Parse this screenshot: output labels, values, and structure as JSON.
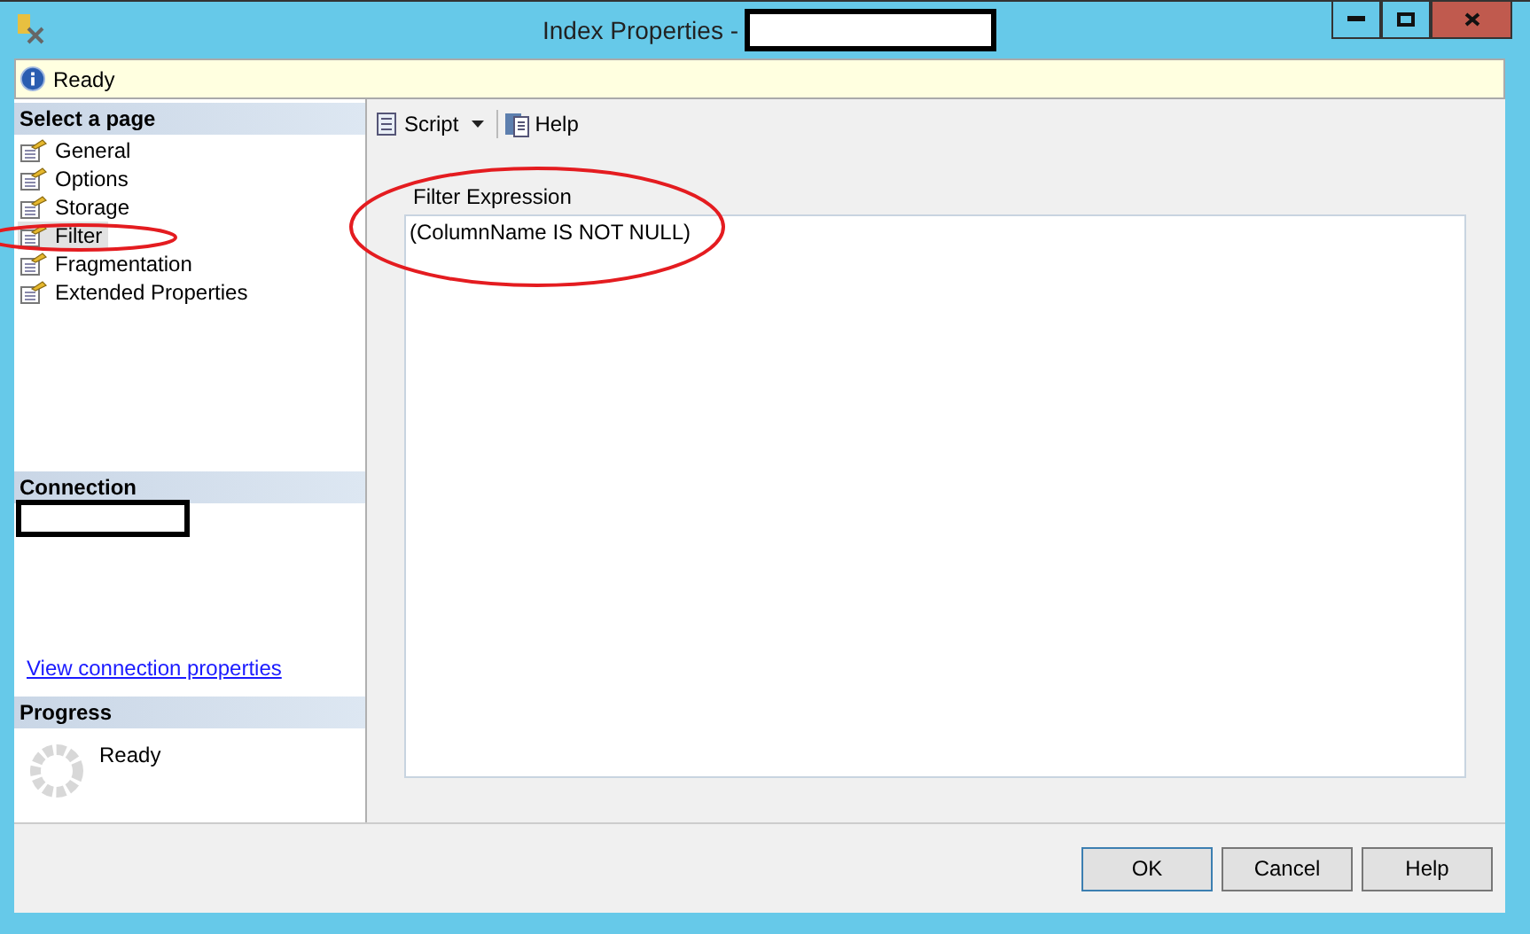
{
  "window": {
    "title": "Index Properties -"
  },
  "info_bar": {
    "text": "Ready"
  },
  "sidebar": {
    "header": "Select a page",
    "items": [
      {
        "label": "General",
        "selected": false
      },
      {
        "label": "Options",
        "selected": false
      },
      {
        "label": "Storage",
        "selected": false
      },
      {
        "label": "Filter",
        "selected": true
      },
      {
        "label": "Fragmentation",
        "selected": false
      },
      {
        "label": "Extended Properties",
        "selected": false
      }
    ]
  },
  "connection": {
    "header": "Connection",
    "link": "View connection properties"
  },
  "progress": {
    "header": "Progress",
    "status": "Ready"
  },
  "toolbar": {
    "script": "Script",
    "help": "Help"
  },
  "filter": {
    "label": "Filter Expression",
    "value": "(ColumnName IS NOT NULL)"
  },
  "buttons": [
    "OK",
    "Cancel",
    "Help"
  ]
}
